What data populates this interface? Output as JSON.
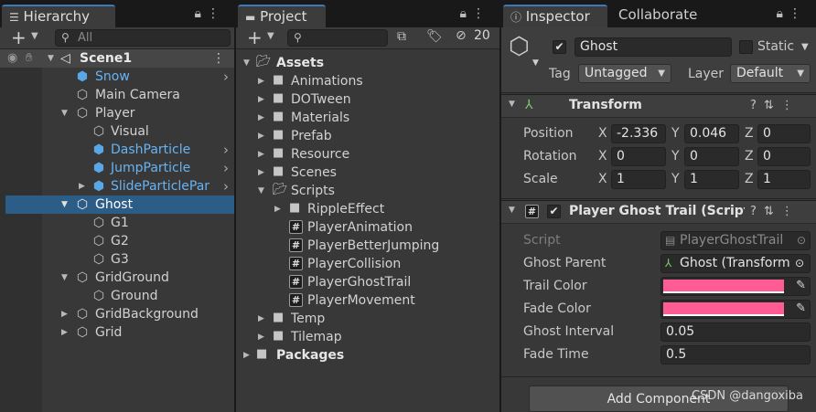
{
  "hierarchy": {
    "tab": "Hierarchy",
    "search_placeholder": "All",
    "scene": "Scene1",
    "items": [
      {
        "label": "Snow",
        "prefab": true,
        "expandable": true
      },
      {
        "label": "Main Camera"
      },
      {
        "label": "Player"
      },
      {
        "label": "Visual"
      },
      {
        "label": "DashParticle",
        "prefab": true
      },
      {
        "label": "JumpParticle",
        "prefab": true
      },
      {
        "label": "SlideParticlePar",
        "prefab": true
      },
      {
        "label": "Ghost",
        "selected": true
      },
      {
        "label": "G1"
      },
      {
        "label": "G2"
      },
      {
        "label": "G3"
      },
      {
        "label": "GridGround"
      },
      {
        "label": "Ground"
      },
      {
        "label": "GridBackground"
      },
      {
        "label": "Grid"
      }
    ]
  },
  "project": {
    "tab": "Project",
    "hidden_count": "20",
    "assets": "Assets",
    "folders": [
      "Animations",
      "DOTween",
      "Materials",
      "Prefab",
      "Resource",
      "Scenes",
      "Scripts"
    ],
    "scripts_children": {
      "folder": "RippleEffect",
      "files": [
        "PlayerAnimation",
        "PlayerBetterJumping",
        "PlayerCollision",
        "PlayerGhostTrail",
        "PlayerMovement"
      ]
    },
    "after": [
      "Temp",
      "Tilemap"
    ],
    "packages": "Packages"
  },
  "inspector": {
    "tab": "Inspector",
    "tab2": "Collaborate",
    "object_name": "Ghost",
    "static_label": "Static",
    "tag_label": "Tag",
    "tag_value": "Untagged",
    "layer_label": "Layer",
    "layer_value": "Default",
    "transform": {
      "title": "Transform",
      "position": {
        "label": "Position",
        "x": "-2.336",
        "y": "0.046",
        "z": "0"
      },
      "rotation": {
        "label": "Rotation",
        "x": "0",
        "y": "0",
        "z": "0"
      },
      "scale": {
        "label": "Scale",
        "x": "1",
        "y": "1",
        "z": "1"
      },
      "axes": [
        "X",
        "Y",
        "Z"
      ]
    },
    "ghost_trail": {
      "title": "Player Ghost Trail (Script)",
      "script_label": "Script",
      "script_value": "PlayerGhostTrail",
      "ghost_parent_label": "Ghost Parent",
      "ghost_parent_value": "Ghost (Transform",
      "trail_color_label": "Trail Color",
      "fade_color_label": "Fade Color",
      "ghost_interval_label": "Ghost Interval",
      "ghost_interval_value": "0.05",
      "fade_time_label": "Fade Time",
      "fade_time_value": "0.5",
      "color": "#ff5c96"
    },
    "add_component": "Add Component"
  },
  "watermark": "CSDN @dangoxiba",
  "colors": {
    "selection": "#2c5d87",
    "prefab_text": "#68b3f2",
    "accent": "#3a79bb"
  }
}
